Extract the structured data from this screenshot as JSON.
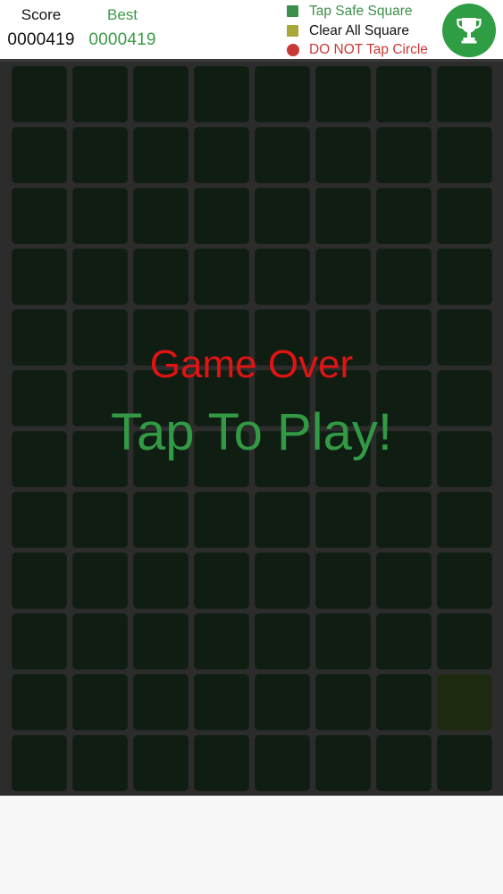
{
  "header": {
    "score_label": "Score",
    "score_value": "0000419",
    "best_label": "Best",
    "best_value": "0000419"
  },
  "legend": [
    {
      "label": "Tap Safe Square",
      "shape": "square",
      "color": "#3c8f4a",
      "text_color": "#3c8f4a"
    },
    {
      "label": "Clear All Square",
      "shape": "square",
      "color": "#a8a83a",
      "text_color": "#111111"
    },
    {
      "label": "DO NOT Tap Circle",
      "shape": "circle",
      "color": "#c83a36",
      "text_color": "#c83a36"
    }
  ],
  "trophy": {
    "icon": "trophy-icon",
    "bg_color": "#2f9d44"
  },
  "board": {
    "rows": 12,
    "columns": 8,
    "cell_color": "#0f1d12",
    "highlight_cell": {
      "row": 11,
      "col": 8,
      "color": "#1e2a10"
    }
  },
  "overlay": {
    "game_over": "Game Over",
    "tap_to_play": "Tap To Play!",
    "game_over_color": "#e11414",
    "tap_to_play_color": "#329944"
  }
}
